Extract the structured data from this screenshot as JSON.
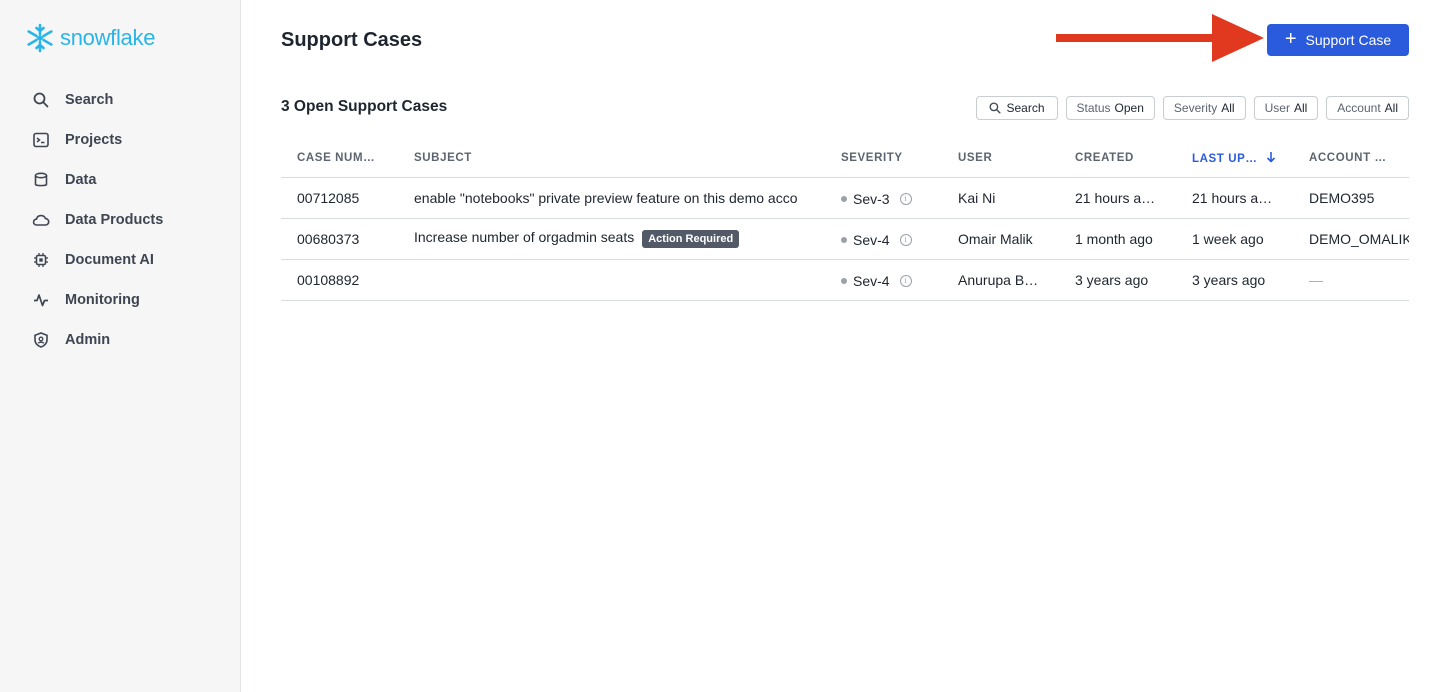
{
  "brand": {
    "name": "snowflake",
    "color": "#29b5e8"
  },
  "sidebar": {
    "items": [
      {
        "label": "Search",
        "icon": "search-icon"
      },
      {
        "label": "Projects",
        "icon": "terminal-icon"
      },
      {
        "label": "Data",
        "icon": "database-icon"
      },
      {
        "label": "Data Products",
        "icon": "cloud-icon"
      },
      {
        "label": "Document AI",
        "icon": "chip-icon"
      },
      {
        "label": "Monitoring",
        "icon": "activity-icon"
      },
      {
        "label": "Admin",
        "icon": "shield-icon"
      }
    ]
  },
  "header": {
    "title": "Support Cases",
    "new_case_button": "Support Case",
    "accent": "#2a5bdc",
    "arrow_color": "#e0391f"
  },
  "cases": {
    "section_title": "3 Open Support Cases",
    "filters": {
      "search": "Search",
      "status_label": "Status",
      "status_value": "Open",
      "severity_label": "Severity",
      "severity_value": "All",
      "user_label": "User",
      "user_value": "All",
      "account_label": "Account",
      "account_value": "All"
    },
    "columns": [
      "CASE NUM…",
      "SUBJECT",
      "SEVERITY",
      "USER",
      "CREATED",
      "LAST UP…",
      "ACCOUNT …"
    ],
    "rows": [
      {
        "case_number": "00712085",
        "subject": "enable \"notebooks\" private preview feature on this demo acco",
        "badge": "",
        "severity": "Sev-3",
        "user": "Kai Ni",
        "created": "21 hours a…",
        "last_updated": "21 hours a…",
        "account": "DEMO395"
      },
      {
        "case_number": "00680373",
        "subject": "Increase number of orgadmin seats",
        "badge": "Action Required",
        "severity": "Sev-4",
        "user": "Omair Malik",
        "created": "1 month ago",
        "last_updated": "1 week ago",
        "account": "DEMO_OMALIK"
      },
      {
        "case_number": "00108892",
        "subject": "",
        "badge": "",
        "severity": "Sev-4",
        "user": "Anurupa Bache",
        "created": "3 years ago",
        "last_updated": "3 years ago",
        "account": "—"
      }
    ]
  }
}
